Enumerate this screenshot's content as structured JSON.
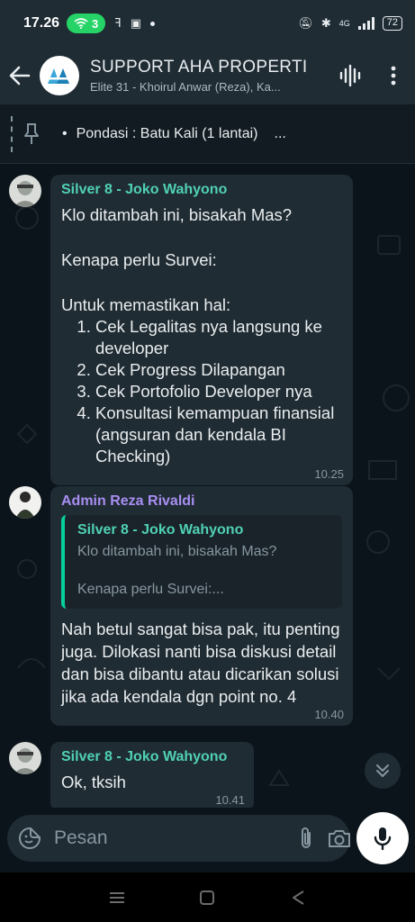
{
  "status_bar": {
    "time": "17.26",
    "hotspot_count": "3",
    "network": "4G",
    "battery": "72"
  },
  "header": {
    "title": "SUPPORT AHA PROPERTI",
    "subtitle": "Elite 31 - Khoirul Anwar (Reza), Ka..."
  },
  "pinned": {
    "text": "Pondasi : Batu Kali (1 lantai)",
    "more": "..."
  },
  "messages": [
    {
      "sender": "Silver 8 - Joko Wahyono",
      "text": "Klo ditambah ini, bisakah Mas?\n\nKenapa perlu Survei:\n\nUntuk memastikan hal:",
      "list": [
        "Cek Legalitas nya langsung ke developer",
        "Cek Progress Dilapangan",
        "Cek Portofolio Developer nya",
        "Konsultasi kemampuan finansial (angsuran dan kendala BI Checking)"
      ],
      "time": "10.25"
    },
    {
      "sender": "Admin Reza Rivaldi",
      "quote": {
        "sender": "Silver 8 - Joko Wahyono",
        "line1": "Klo ditambah ini, bisakah Mas?",
        "line2": "Kenapa perlu Survei:..."
      },
      "text": "Nah betul sangat bisa pak, itu penting juga. Dilokasi nanti bisa diskusi detail dan bisa dibantu atau dicarikan solusi jika ada kendala dgn point no. 4",
      "time": "10.40"
    },
    {
      "sender": "Silver 8 - Joko Wahyono",
      "text": "Ok, tksih",
      "time": "10.41"
    }
  ],
  "input": {
    "placeholder": "Pesan"
  },
  "colors": {
    "header_bg": "#1f2c34",
    "bubble_bg": "#202c33",
    "accent_green": "#25d366",
    "sender_teal": "#4fd1b5",
    "sender_purple": "#a88ef2"
  }
}
